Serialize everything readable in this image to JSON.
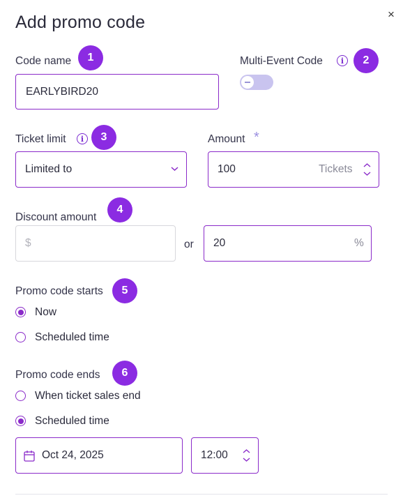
{
  "dialog": {
    "title": "Add promo code",
    "close_icon": "×"
  },
  "code_name": {
    "label": "Code name",
    "value": "EARLYBIRD20",
    "badge": "1"
  },
  "multi_event": {
    "label": "Multi-Event Code",
    "badge": "2",
    "enabled": false,
    "info_icon": "i"
  },
  "ticket_limit": {
    "label": "Ticket limit",
    "badge": "3",
    "selected": "Limited to",
    "info_icon": "i"
  },
  "amount": {
    "label": "Amount",
    "required_mark": "*",
    "value": "100",
    "unit": "Tickets"
  },
  "discount": {
    "label": "Discount amount",
    "badge": "4",
    "dollar_placeholder": "$",
    "or_text": "or",
    "percent_value": "20",
    "percent_suffix": "%"
  },
  "starts": {
    "label": "Promo code starts",
    "badge": "5",
    "options": [
      {
        "label": "Now",
        "checked": true
      },
      {
        "label": "Scheduled time",
        "checked": false
      }
    ]
  },
  "ends": {
    "label": "Promo code ends",
    "badge": "6",
    "options": [
      {
        "label": "When ticket sales end",
        "checked": false
      },
      {
        "label": "Scheduled time",
        "checked": true
      }
    ],
    "date": "Oct 24, 2025",
    "time": "12:00"
  },
  "colors": {
    "accent": "#8a2ac9",
    "badge": "#8b2be2",
    "toggle_track": "#c9c4ef"
  }
}
